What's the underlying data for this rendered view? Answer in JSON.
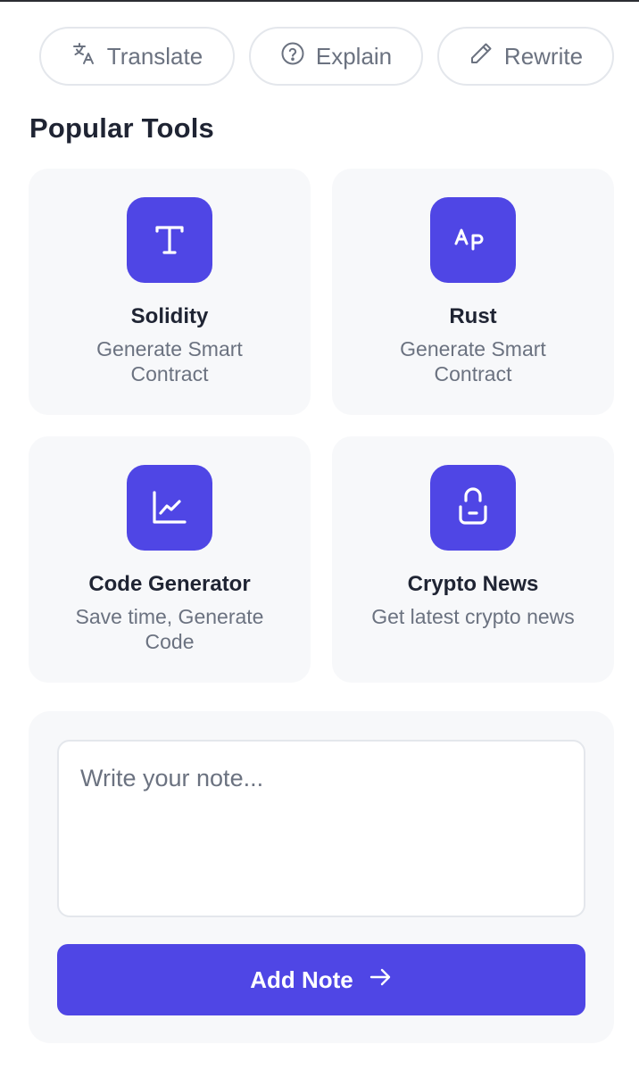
{
  "actions": {
    "translate_label": "Translate",
    "explain_label": "Explain",
    "rewrite_label": "Rewrite"
  },
  "section": {
    "title": "Popular Tools"
  },
  "tools": [
    {
      "name": "Solidity",
      "description": "Generate Smart Contract",
      "icon": "text-t-icon"
    },
    {
      "name": "Rust",
      "description": "Generate Smart Contract",
      "icon": "ap-letters-icon"
    },
    {
      "name": "Code Generator",
      "description": "Save time, Generate Code",
      "icon": "chart-line-icon"
    },
    {
      "name": "Crypto News",
      "description": "Get latest crypto news",
      "icon": "lock-open-icon"
    }
  ],
  "note": {
    "placeholder": "Write your note...",
    "value": "",
    "button_label": "Add Note"
  },
  "colors": {
    "accent": "#4f46e5",
    "card_bg": "#f7f8fa",
    "text_primary": "#1f2433",
    "text_secondary": "#6b7280",
    "border": "#e4e7ec"
  }
}
